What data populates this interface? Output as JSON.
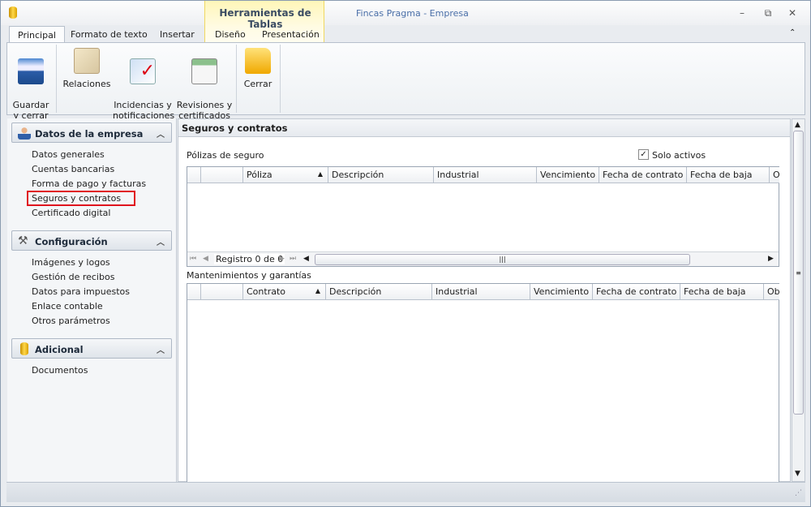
{
  "window": {
    "app_title": "Fincas Pragma - Empresa",
    "context_group": "Herramientas de Tablas"
  },
  "tabs": [
    "Principal",
    "Formato de texto",
    "Insertar",
    "Diseño",
    "Presentación"
  ],
  "ribbon": {
    "save": "Guardar\ny cerrar",
    "relations": "Relaciones",
    "incidents": "Incidencias y\nnotificaciones",
    "reviews": "Revisiones y\ncertificados",
    "close": "Cerrar"
  },
  "sidebar": {
    "groups": [
      {
        "title": "Datos de la empresa",
        "items": [
          "Datos generales",
          "Cuentas bancarias",
          "Forma de pago y facturas",
          "Seguros y contratos",
          "Certificado digital"
        ]
      },
      {
        "title": "Configuración",
        "items": [
          "Imágenes y logos",
          "Gestión de recibos",
          "Datos para impuestos",
          "Enlace contable",
          "Otros parámetros"
        ]
      },
      {
        "title": "Adicional",
        "items": [
          "Documentos"
        ]
      }
    ]
  },
  "main": {
    "title": "Seguros y contratos",
    "policies": {
      "label": "Pólizas de seguro",
      "only_active": "Solo activos",
      "only_active_checked": true,
      "columns": [
        "Póliza",
        "Descripción",
        "Industrial",
        "Vencimiento",
        "Fecha de contrato",
        "Fecha de baja",
        "O"
      ],
      "navigator": "Registro 0 de 0"
    },
    "maintenance": {
      "label": "Mantenimientos y garantías",
      "columns": [
        "Contrato",
        "Descripción",
        "Industrial",
        "Vencimiento",
        "Fecha de contrato",
        "Fecha de baja",
        "Obs"
      ]
    }
  }
}
